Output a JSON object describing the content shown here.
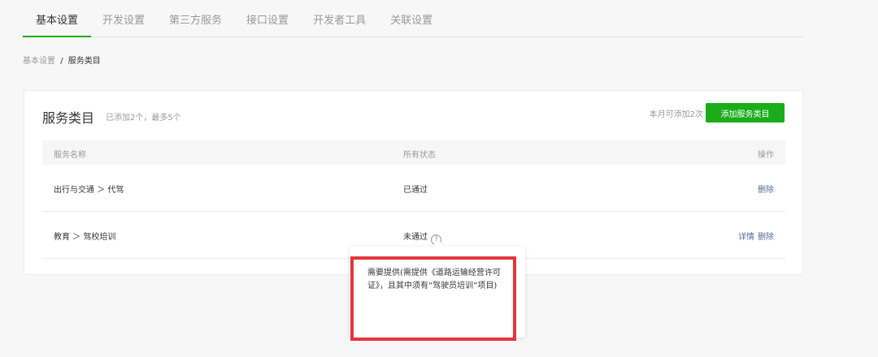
{
  "tabs": [
    {
      "label": "基本设置",
      "active": true
    },
    {
      "label": "开发设置"
    },
    {
      "label": "第三方服务"
    },
    {
      "label": "接口设置"
    },
    {
      "label": "开发者工具"
    },
    {
      "label": "关联设置"
    }
  ],
  "breadcrumb": {
    "parent": "基本设置",
    "separator": "/",
    "current": "服务类目"
  },
  "card": {
    "title": "服务类目",
    "subtitle": "已添加2个，最多5个",
    "quota": "本月可添加2次",
    "add_button": "添加服务类目"
  },
  "table": {
    "headers": {
      "name": "服务名称",
      "status": "所有状态",
      "op": "操作"
    },
    "rows": [
      {
        "name": "出行与交通 ＞ 代驾",
        "status": "已通过",
        "actions": [
          "删除"
        ]
      },
      {
        "name": "教育 ＞ 驾校培训",
        "status": "未通过",
        "help": "?",
        "actions": [
          "详情",
          "删除"
        ]
      }
    ]
  },
  "tooltip": {
    "text": "需要提供(需提供《道路运输经营许可证》，且其中须有“驾驶员培训”项目)"
  },
  "colors": {
    "accent": "#1aad19",
    "link": "#576b95",
    "highlight": "#e8343b"
  }
}
